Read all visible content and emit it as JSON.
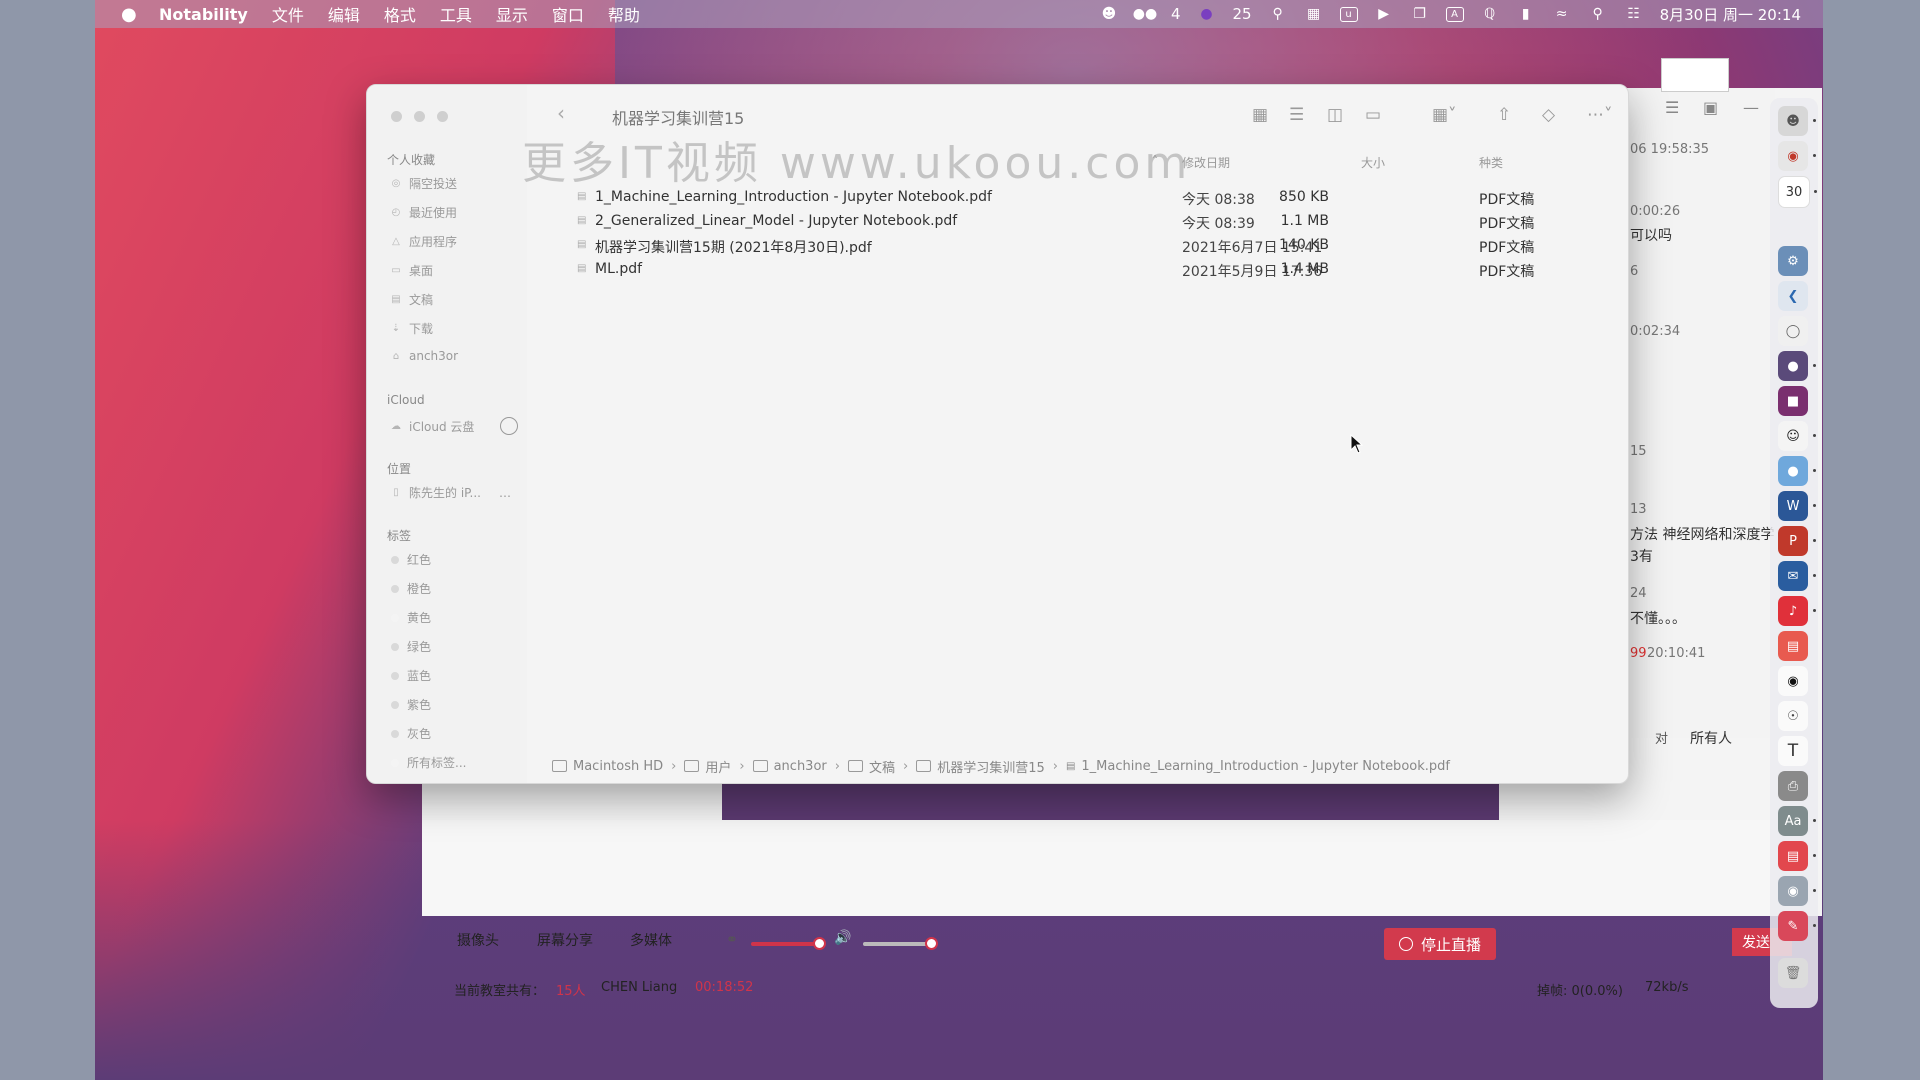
{
  "menubar": {
    "apple": "",
    "app": "Notability",
    "menus": [
      "文件",
      "编辑",
      "格式",
      "工具",
      "显示",
      "窗口",
      "帮助"
    ],
    "wechat_count": "4",
    "badge_count": "25",
    "clock": "8月30日 周一  20:14"
  },
  "finder": {
    "title": "机器学习集训营15",
    "watermark": "更多IT视频 www.ukoou.com",
    "sidebar": {
      "favorites_header": "个人收藏",
      "favorites": [
        "隔空投送",
        "最近使用",
        "应用程序",
        "桌面",
        "文稿",
        "下载",
        "anch3or"
      ],
      "icloud_header": "iCloud",
      "icloud_items": [
        "iCloud 云盘"
      ],
      "locations_header": "位置",
      "locations": [
        "陈先生的 iP..."
      ],
      "tags_header": "标签",
      "tags": [
        {
          "label": "红色",
          "color": "#d9d9d9"
        },
        {
          "label": "橙色",
          "color": "#d9d9d9"
        },
        {
          "label": "黄色",
          "color": "#f4f4f4"
        },
        {
          "label": "绿色",
          "color": "#d9d9d9"
        },
        {
          "label": "蓝色",
          "color": "#d9d9d9"
        },
        {
          "label": "紫色",
          "color": "#d9d9d9"
        },
        {
          "label": "灰色",
          "color": "#d9d9d9"
        },
        {
          "label": "所有标签...",
          "color": "#f4f4f4"
        }
      ]
    },
    "columns": {
      "date": "修改日期",
      "size": "大小",
      "kind": "种类"
    },
    "files": [
      {
        "name": "1_Machine_Learning_Introduction - Jupyter Notebook.pdf",
        "date": "今天 08:38",
        "size": "850 KB",
        "kind": "PDF文稿"
      },
      {
        "name": "2_Generalized_Linear_Model - Jupyter Notebook.pdf",
        "date": "今天 08:39",
        "size": "1.1 MB",
        "kind": "PDF文稿"
      },
      {
        "name": "机器学习集训营15期 (2021年8月30日).pdf",
        "date": "2021年6月7日 15:41",
        "size": "140 KB",
        "kind": "PDF文稿"
      },
      {
        "name": "ML.pdf",
        "date": "2021年5月9日 17:36",
        "size": "1.4 MB",
        "kind": "PDF文稿"
      }
    ],
    "path": [
      "Macintosh HD",
      "用户",
      "anch3or",
      "文稿",
      "机器学习集训营15",
      "1_Machine_Learning_Introduction - Jupyter Notebook.pdf"
    ]
  },
  "liveapp": {
    "chat": [
      {
        "text": "06 19:58:35",
        "style": "time"
      },
      {
        "text": "0:00:26",
        "style": "time"
      },
      {
        "text": "可以吗",
        "style": "msg"
      },
      {
        "text": "6",
        "style": "time"
      },
      {
        "text": "0:02:34",
        "style": "time"
      },
      {
        "text": "15",
        "style": "time"
      },
      {
        "text": "13",
        "style": "time"
      },
      {
        "text": "方法 神经网络和深度学",
        "style": "msg"
      },
      {
        "text": "3有",
        "style": "msg"
      },
      {
        "text": "24",
        "style": "time"
      },
      {
        "text": "不懂。。。",
        "style": "msg"
      },
      {
        "text": "99",
        "style": "red"
      },
      {
        "text": "20:10:41",
        "style": "time"
      }
    ],
    "chat_to_label": "对",
    "chat_to_value": "所有人",
    "send": "发送",
    "camera": "摄像头",
    "screen_share": "屏幕分享",
    "media": "多媒体",
    "stop_live": "停止直播",
    "room_label": "当前教室共有：",
    "room_count": "15人",
    "user": "CHEN Liang",
    "elapsed": "00:18:52",
    "drop_frames": "掉帧: 0(0.0%)",
    "bitrate": "72kb/s"
  },
  "dock": {
    "calendar_day": "30"
  }
}
